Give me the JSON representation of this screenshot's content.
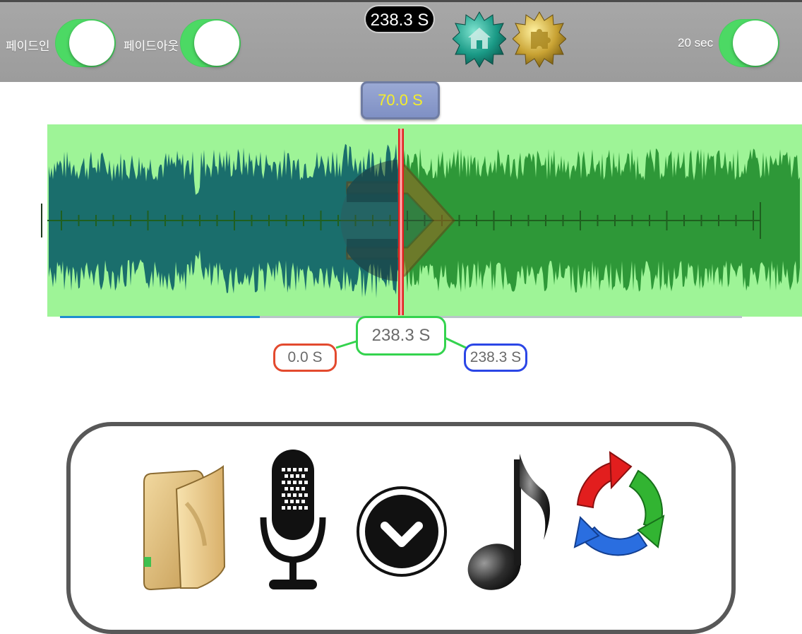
{
  "topbar": {
    "fade_in_label": "페이드인",
    "fade_in_on": true,
    "fade_out_label": "페이드아웃",
    "fade_out_on": true,
    "total_duration": "238.3 S",
    "duration_label": "20 sec",
    "duration_on": true,
    "home_icon": "home-star-badge-icon",
    "plugin_icon": "puzzle-star-badge-icon"
  },
  "editor": {
    "playhead_label": "70.0 S",
    "current_time": "238.3 S",
    "start_time": "0.0 S",
    "end_time": "238.3 S",
    "playback_progress": 0.293,
    "played_color": "#1a6e6c",
    "wave_color": "#2e9838",
    "wave_bg_color": "#9ef497",
    "playhead_color": "#e02020"
  },
  "tools": {
    "folder_icon": "folder-icon",
    "mic_icon": "microphone-icon",
    "down_icon": "download-circle-icon",
    "note_icon": "music-note-icon",
    "refresh_icon": "refresh-cycle-icon"
  }
}
